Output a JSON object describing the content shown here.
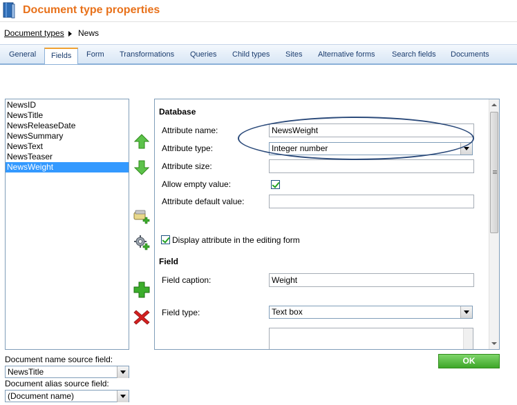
{
  "header": {
    "title": "Document type properties"
  },
  "breadcrumb": {
    "parent": "Document types",
    "current": "News"
  },
  "tabs": [
    "General",
    "Fields",
    "Form",
    "Transformations",
    "Queries",
    "Child types",
    "Sites",
    "Alternative forms",
    "Search fields",
    "Documents"
  ],
  "active_tab": "Fields",
  "fields": [
    "NewsID",
    "NewsTitle",
    "NewsReleaseDate",
    "NewsSummary",
    "NewsText",
    "NewsTeaser",
    "NewsWeight"
  ],
  "selected_field": "NewsWeight",
  "database": {
    "heading": "Database",
    "attribute_name_label": "Attribute name:",
    "attribute_name_value": "NewsWeight",
    "attribute_type_label": "Attribute type:",
    "attribute_type_value": "Integer number",
    "attribute_size_label": "Attribute size:",
    "attribute_size_value": "",
    "allow_empty_label": "Allow empty value:",
    "allow_empty_checked": true,
    "default_value_label": "Attribute default value:",
    "default_value_value": "",
    "display_in_form_label": "Display attribute in the editing form",
    "display_in_form_checked": true
  },
  "field": {
    "heading": "Field",
    "caption_label": "Field caption:",
    "caption_value": "Weight",
    "type_label": "Field type:",
    "type_value": "Text box"
  },
  "buttons": {
    "ok": "OK"
  },
  "sources": {
    "name_label": "Document name source field:",
    "name_value": "NewsTitle",
    "alias_label": "Document alias source field:",
    "alias_value": "(Document name)"
  },
  "icons": {
    "move_up": "arrow-up-icon",
    "move_down": "arrow-down-icon",
    "new_attribute": "new-attribute-icon",
    "new_category": "new-category-icon",
    "add": "plus-icon",
    "delete": "delete-icon"
  },
  "colors": {
    "title": "#e8711a",
    "selection": "#3399ff",
    "ok": "#3ea628",
    "oval": "#2b4a7a"
  }
}
